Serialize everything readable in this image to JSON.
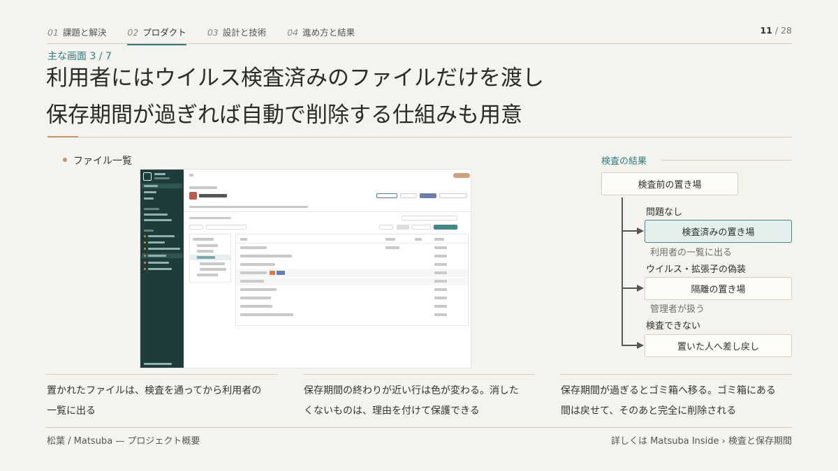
{
  "nav": {
    "items": [
      {
        "num": "01",
        "label": "課題と解決"
      },
      {
        "num": "02",
        "label": "プロダクト"
      },
      {
        "num": "03",
        "label": "設計と技術"
      },
      {
        "num": "04",
        "label": "進め方と結果"
      }
    ],
    "active_index": 1,
    "page_current": "11",
    "page_total": "/ 28"
  },
  "kicker": "主な画面 3 / 7",
  "title": {
    "line1": "利用者にはウイルス検査済みのファイルだけを渡し",
    "line2": "保存期間が過ぎれば自動で削除する仕組みも用意"
  },
  "bullet": "ファイル一覧",
  "flow": {
    "label": "検査の結果",
    "start": "検査前の置き場",
    "branches": [
      {
        "condition": "問題なし",
        "target": "検査済みの置き場",
        "note": "利用者の一覧に出る",
        "highlight": true
      },
      {
        "condition": "ウイルス・拡張子の偽装",
        "target": "隔離の置き場",
        "note": "管理者が扱う",
        "highlight": false
      },
      {
        "condition": "検査できない",
        "target": "置いた人へ差し戻し",
        "note": "",
        "highlight": false
      }
    ]
  },
  "captions": [
    {
      "line1": "置かれたファイルは、検査を通ってから利用者の",
      "line2": "一覧に出る"
    },
    {
      "line1": "保存期間の終わりが近い行は色が変わる。消した",
      "line2": "くないものは、理由を付けて保護できる"
    },
    {
      "line1": "保存期間が過ぎるとゴミ箱へ移る。ゴミ箱にある",
      "line2": "間は戻せて、そのあと完全に削除される"
    }
  ],
  "footer": {
    "left": "松葉 / Matsuba — プロジェクト概要",
    "right": "詳しくは Matsuba Inside › 検査と保存期間"
  },
  "colors": {
    "accent": "#2c7d80",
    "copper": "#c89468",
    "background": "#f4f3ee",
    "highlight_fill": "#e2efec"
  }
}
